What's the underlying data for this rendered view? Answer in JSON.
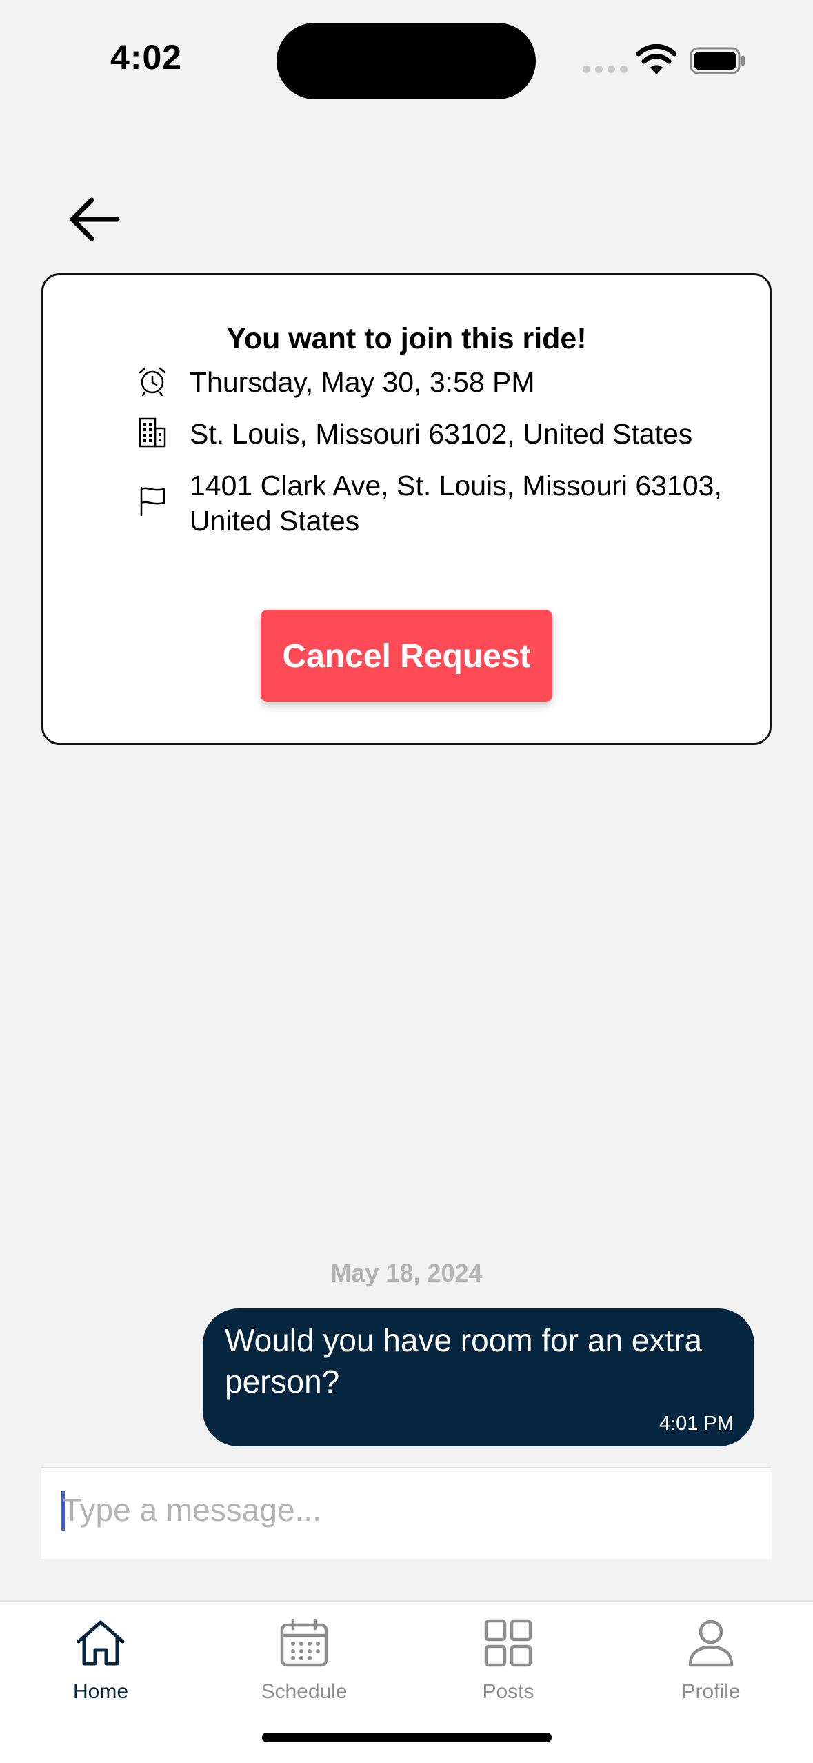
{
  "status_bar": {
    "time": "4:02"
  },
  "ride_card": {
    "title": "You want to join this ride!",
    "datetime": "Thursday, May 30, 3:58 PM",
    "origin": "St. Louis, Missouri 63102, United States",
    "destination": "1401 Clark Ave, St. Louis, Missouri 63103, United States",
    "cancel_label": "Cancel Request",
    "icons": [
      "alarm-clock-icon",
      "building-icon",
      "flag-icon"
    ]
  },
  "chat": {
    "date": "May 18, 2024",
    "messages": [
      {
        "text": "Would you have room for an extra person?",
        "time": "4:01 PM"
      }
    ],
    "input_placeholder": "Type a message..."
  },
  "tabs": [
    {
      "label": "Home",
      "icon": "home-icon",
      "active": true
    },
    {
      "label": "Schedule",
      "icon": "calendar-icon",
      "active": false
    },
    {
      "label": "Posts",
      "icon": "grid-icon",
      "active": false
    },
    {
      "label": "Profile",
      "icon": "person-icon",
      "active": false
    }
  ],
  "colors": {
    "accent_navy": "#06263f",
    "cancel_red": "#ff4b55",
    "background": "#f2f2f2"
  }
}
